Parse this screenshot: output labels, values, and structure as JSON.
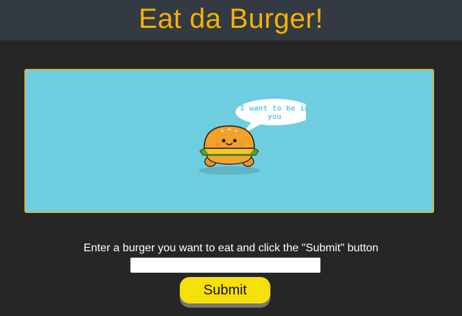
{
  "header": {
    "title": "Eat da Burger!"
  },
  "banner": {
    "speech_bubble_text": "I want to be in you",
    "mascot_icon": "smiling-burger-icon",
    "background_color": "#6fcde0",
    "border_color": "#d6b445"
  },
  "form": {
    "prompt": "Enter a burger you want to eat and click the \"Submit\" button",
    "input_value": "",
    "input_placeholder": "",
    "submit_label": "Submit"
  },
  "colors": {
    "page_background": "#262626",
    "header_background": "#343a42",
    "title": "#f5b400",
    "button": "#f5e00a"
  }
}
